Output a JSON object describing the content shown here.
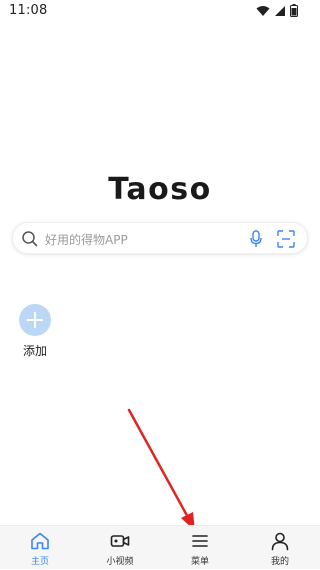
{
  "status_bar": {
    "time": "11:08"
  },
  "logo": {
    "text": "Taoso"
  },
  "search": {
    "placeholder": "好用的得物APP"
  },
  "add": {
    "label": "添加"
  },
  "bottom_nav": {
    "items": [
      {
        "label": "主页",
        "icon": "home-icon",
        "active": true
      },
      {
        "label": "小视频",
        "icon": "video-camera-icon",
        "active": false
      },
      {
        "label": "菜单",
        "icon": "menu-icon",
        "active": false
      },
      {
        "label": "我的",
        "icon": "person-icon",
        "active": false
      }
    ]
  },
  "colors": {
    "accent": "#3a86f0",
    "add_button": "#bcd6f5",
    "annotation_arrow": "#e02424"
  }
}
